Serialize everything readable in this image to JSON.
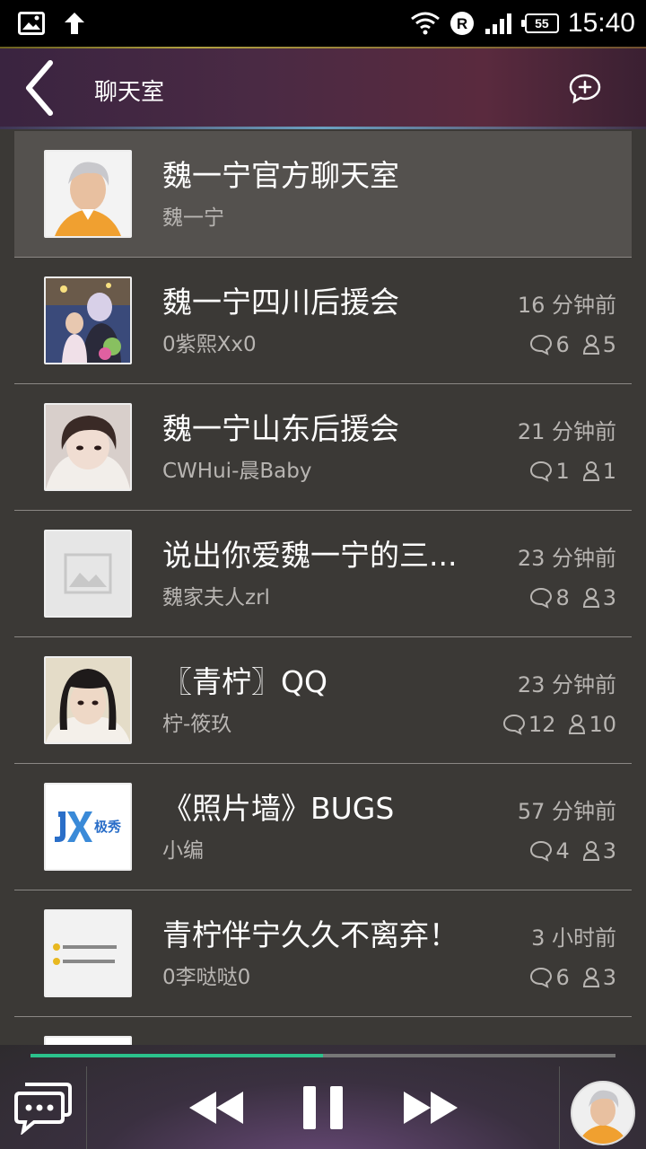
{
  "status_bar": {
    "time": "15:40",
    "battery": "55",
    "icons": [
      "image-icon",
      "upload-arrow-icon",
      "wifi-icon",
      "roaming-r-icon",
      "signal-icon",
      "battery-icon"
    ]
  },
  "header": {
    "title": "聊天室",
    "back_icon": "chevron-left-icon",
    "compose_icon": "chat-bubble-plus-icon"
  },
  "rooms": [
    {
      "title": "魏一宁官方聊天室",
      "owner": "魏一宁",
      "time": "",
      "comments": "",
      "members": "",
      "selected": true,
      "avatar": "person-photo-orange"
    },
    {
      "title": "魏一宁四川后援会",
      "owner": "0紫熙Xx0",
      "time": "16 分钟前",
      "comments": "6",
      "members": "5",
      "selected": false,
      "avatar": "group-photo"
    },
    {
      "title": "魏一宁山东后援会",
      "owner": "CWHui-晨Baby",
      "time": "21 分钟前",
      "comments": "1",
      "members": "1",
      "selected": false,
      "avatar": "girl-photo"
    },
    {
      "title": "说出你爱魏一宁的三...",
      "owner": "魏家夫人zrl",
      "time": "23 分钟前",
      "comments": "8",
      "members": "3",
      "selected": false,
      "avatar": "placeholder-image"
    },
    {
      "title": "〖青柠〗QQ",
      "owner": "柠-筱玖",
      "time": "23 分钟前",
      "comments": "12",
      "members": "10",
      "selected": false,
      "avatar": "girl-bangs-photo"
    },
    {
      "title": "《照片墙》BUGS",
      "owner": "小编",
      "time": "57 分钟前",
      "comments": "4",
      "members": "3",
      "selected": false,
      "avatar": "jixiu-logo"
    },
    {
      "title": "青柠伴宁久久不离弃！",
      "owner": "0李哒哒0",
      "time": "3 小时前",
      "comments": "6",
      "members": "3",
      "selected": false,
      "avatar": "text-note-image"
    }
  ],
  "player": {
    "progress": 0.5,
    "accent_color": "#2bc28c",
    "controls": [
      "chat-icon",
      "previous-icon",
      "pause-icon",
      "next-icon"
    ]
  },
  "logo_text": "极秀"
}
